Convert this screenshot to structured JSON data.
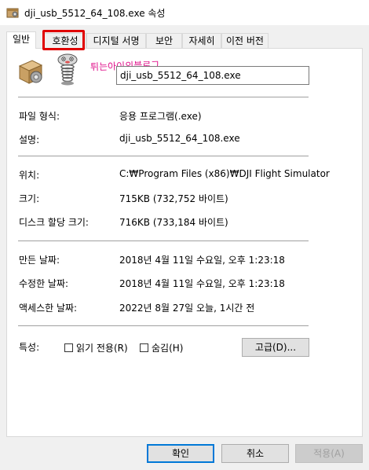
{
  "window": {
    "title": "dji_usb_5512_64_108.exe 속성",
    "icon": "application-exe-icon"
  },
  "tabs": [
    {
      "label": "일반",
      "active": true
    },
    {
      "label": "호환성",
      "highlighted": true
    },
    {
      "label": "디지털 서명"
    },
    {
      "label": "보안"
    },
    {
      "label": "자세히"
    },
    {
      "label": "이전 버전"
    }
  ],
  "header": {
    "file_icon": "exe-setup-box-icon",
    "mascot": "spring-mascot-image",
    "watermark": "튀는아이의블로그",
    "filename": "dji_usb_5512_64_108.exe"
  },
  "properties": {
    "file_type": {
      "label": "파일 형식:",
      "value": "응용 프로그램(.exe)"
    },
    "description": {
      "label": "설명:",
      "value": "dji_usb_5512_64_108.exe"
    },
    "location": {
      "label": "위치:",
      "value": "C:₩Program Files (x86)₩DJI Flight Simulator"
    },
    "size": {
      "label": "크기:",
      "value": "715KB (732,752 바이트)"
    },
    "size_on_disk": {
      "label": "디스크 할당 크기:",
      "value": "716KB (733,184 바이트)"
    },
    "created": {
      "label": "만든 날짜:",
      "value": "2018년 4월 11일 수요일, 오후 1:23:18"
    },
    "modified": {
      "label": "수정한 날짜:",
      "value": "2018년 4월 11일 수요일, 오후 1:23:18"
    },
    "accessed": {
      "label": "액세스한 날짜:",
      "value": "2022년 8월 27일 오늘, 1시간 전"
    }
  },
  "attributes": {
    "label": "특성:",
    "readonly": {
      "label": "읽기 전용(R)",
      "checked": false
    },
    "hidden": {
      "label": "숨김(H)",
      "checked": false
    },
    "advanced_button": "고급(D)..."
  },
  "buttons": {
    "ok": "확인",
    "cancel": "취소",
    "apply": "적용(A)"
  }
}
